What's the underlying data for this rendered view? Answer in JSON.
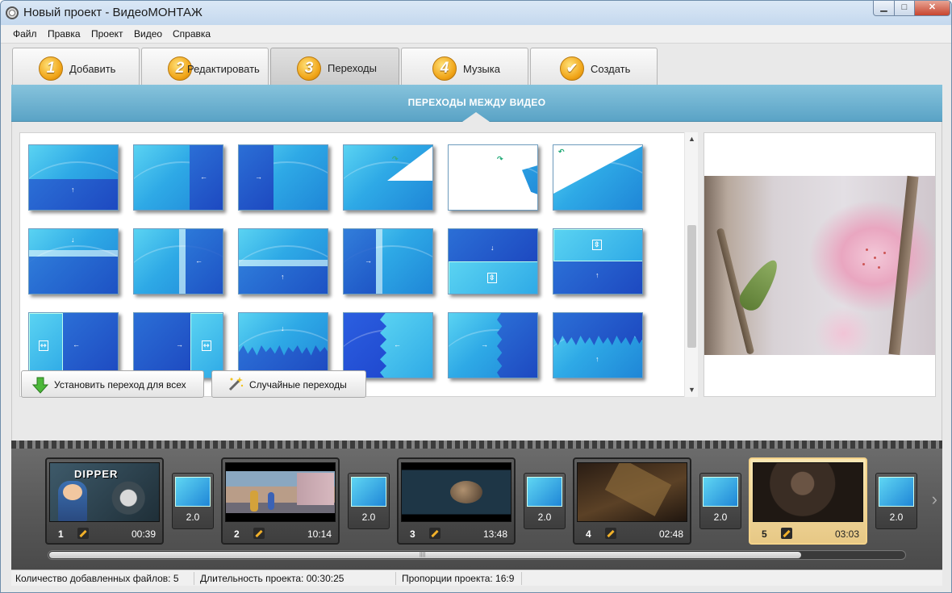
{
  "window": {
    "title": "Новый проект - ВидеоМОНТАЖ",
    "min": "▁",
    "max": "□",
    "close": "✕"
  },
  "menu": [
    "Файл",
    "Правка",
    "Проект",
    "Видео",
    "Справка"
  ],
  "tabs": [
    {
      "num": "1",
      "label": "Добавить"
    },
    {
      "num": "2",
      "label": "Редактировать"
    },
    {
      "num": "3",
      "label": "Переходы",
      "active": true
    },
    {
      "num": "4",
      "label": "Музыка"
    },
    {
      "num": "✔",
      "label": "Создать"
    }
  ],
  "section_title": "ПЕРЕХОДЫ МЕЖДУ ВИДЕО",
  "actions": {
    "apply_all": "Установить переход для всех",
    "random": "Случайные переходы"
  },
  "timeline": {
    "clips": [
      {
        "num": "1",
        "duration": "00:39",
        "title_text": "DIPPER"
      },
      {
        "num": "2",
        "duration": "10:14"
      },
      {
        "num": "3",
        "duration": "13:48"
      },
      {
        "num": "4",
        "duration": "02:48"
      },
      {
        "num": "5",
        "duration": "03:03",
        "selected": true
      }
    ],
    "transitions": [
      "2.0",
      "2.0",
      "2.0",
      "2.0",
      "2.0"
    ]
  },
  "status": {
    "files": "Количество добавленных файлов: 5",
    "duration": "Длительность проекта:  00:30:25",
    "ratio": "Пропорции проекта:  16:9"
  },
  "colors": {
    "accent": "#5aa3c6",
    "selected_clip": "#f4d38a"
  }
}
